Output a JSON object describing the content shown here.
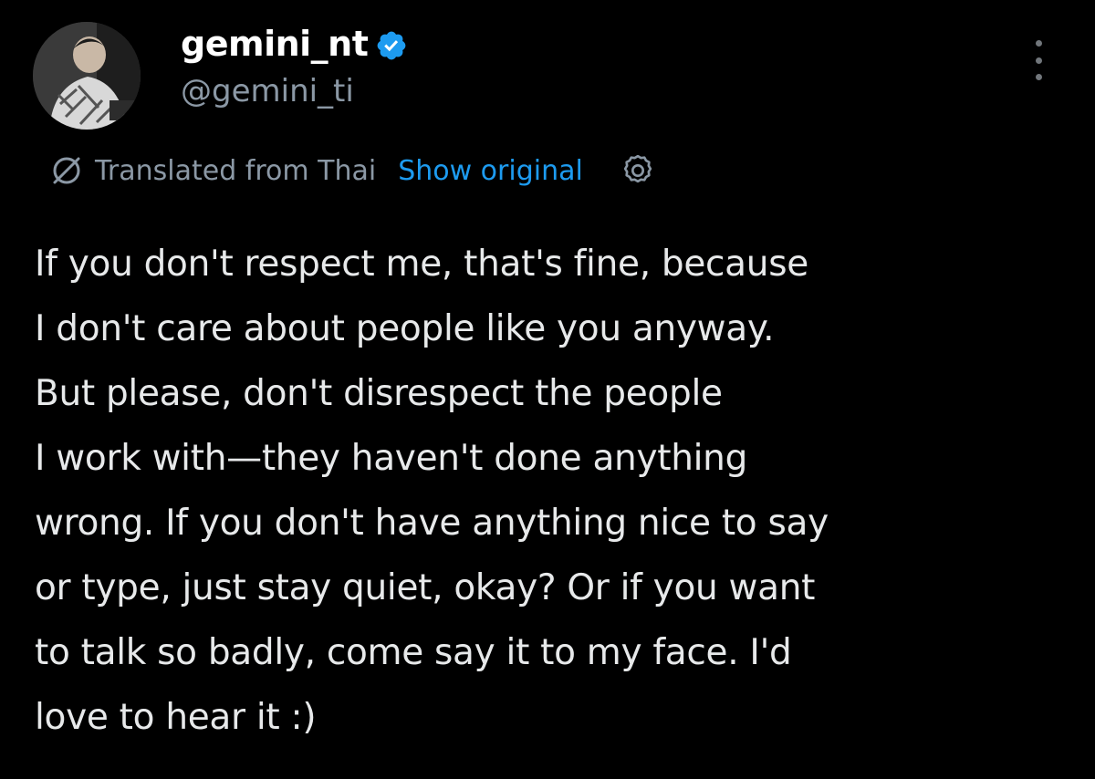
{
  "author": {
    "display_name": "gemini_nt",
    "handle": "@gemini_ti",
    "verified": true,
    "avatar_icon": "profile-photo"
  },
  "translation": {
    "label": "Translated from Thai",
    "show_original_label": "Show original",
    "icon": "translate-icon",
    "settings_icon": "gear-icon"
  },
  "tweet": {
    "text": "If you don't respect me, that's fine, because\nI don't care about people like you anyway.\nBut please, don't disrespect the people\nI work with—they haven't done anything\nwrong. If you don't have anything nice to say\nor type, just stay quiet, okay? Or if you want\nto talk so badly, come say it to my face. I'd\nlove to hear it :)"
  },
  "menu": {
    "icon": "more-vertical-icon"
  },
  "colors": {
    "background": "#000000",
    "text": "#e7e9ea",
    "secondary": "#8b98a5",
    "link": "#1d9bf0",
    "verified": "#1d9bf0"
  }
}
